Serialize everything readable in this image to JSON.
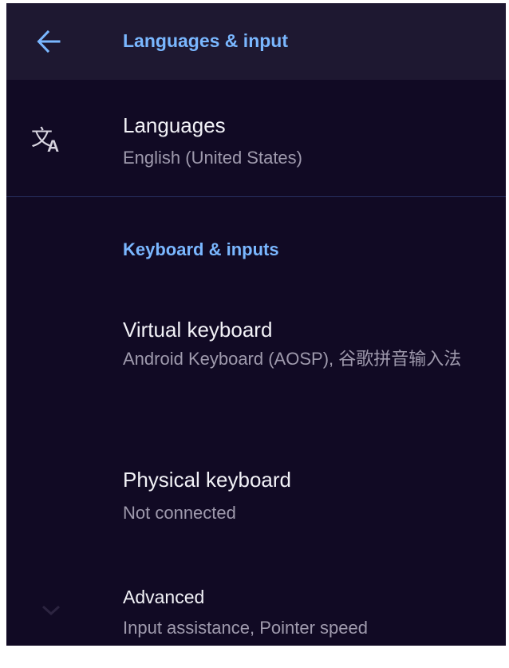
{
  "colors": {
    "background": "#110a24",
    "appbar": "#1e1831",
    "accent": "#7ab7ff",
    "primary_text": "#f2f2f7",
    "secondary_text": "#9f9aad",
    "divider": "#283060"
  },
  "appbar": {
    "back_icon": "arrow-back-icon",
    "title": "Languages & input"
  },
  "languages": {
    "icon": "translate-icon",
    "title": "Languages",
    "summary": "English (United States)"
  },
  "keyboard_section": {
    "header": "Keyboard & inputs",
    "virtual_keyboard": {
      "title": "Virtual keyboard",
      "summary": "Android Keyboard (AOSP), 谷歌拼音输入法"
    },
    "physical_keyboard": {
      "title": "Physical keyboard",
      "summary": "Not connected"
    }
  },
  "advanced": {
    "icon": "chevron-down-icon",
    "title": "Advanced",
    "summary": "Input assistance, Pointer speed"
  }
}
